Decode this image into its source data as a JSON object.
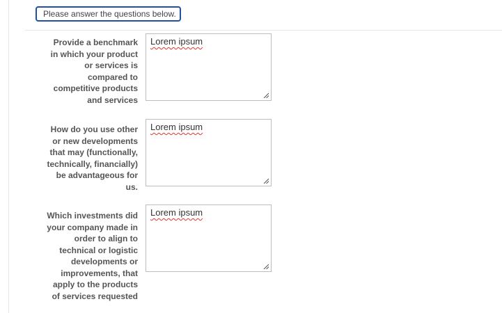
{
  "form": {
    "instruction": "Please answer the questions below.",
    "questions": [
      {
        "label_lines": [
          "Provide a benchmark",
          "in which your product",
          "or services is",
          "compared to",
          "competitive products",
          "and services"
        ],
        "answer": "Lorem ipsum"
      },
      {
        "label_lines": [
          "How do you use other",
          "or new developments",
          "that may (functionally,",
          "technically, financially)",
          "be advantageous for",
          "us."
        ],
        "answer": "Lorem ipsum"
      },
      {
        "label_lines": [
          "Which investments did",
          "your company made in",
          "order to align to",
          "technical or logistic",
          "developments or",
          "improvements, that",
          "apply to the products",
          "of services requested"
        ],
        "answer": "Lorem ipsum"
      }
    ]
  },
  "icons": {
    "resize": "resize-grip-icon"
  },
  "colors": {
    "instruction_border": "#1f4fa8",
    "label_text": "#555555",
    "spellcheck_underline": "#e0332f"
  }
}
